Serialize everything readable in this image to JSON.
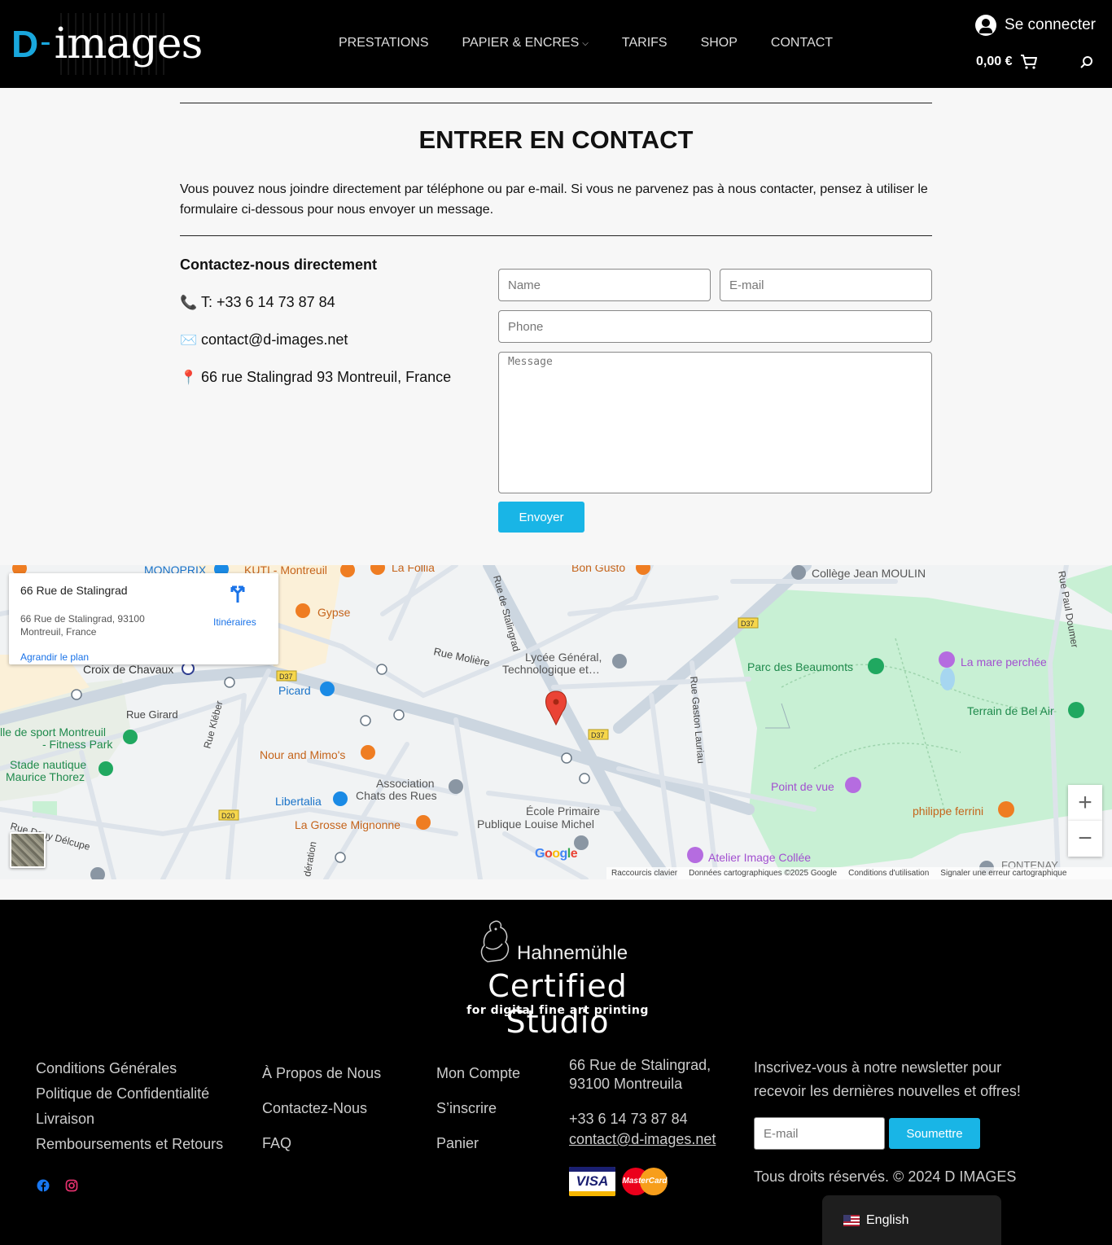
{
  "header": {
    "logo_d": "D",
    "logo_dash": "-",
    "logo_images": "images",
    "nav": [
      {
        "label": "PRESTATIONS"
      },
      {
        "label": "PAPIER & ENCRES",
        "has_dropdown": true
      },
      {
        "label": "TARIFS"
      },
      {
        "label": "SHOP"
      },
      {
        "label": "CONTACT"
      }
    ],
    "login_label": "Se connecter",
    "cart_total": "0,00 €"
  },
  "contact": {
    "title": "ENTRER EN CONTACT",
    "intro": "Vous pouvez nous joindre directement par téléphone ou par e-mail. Si vous ne parvenez pas à nous contacter, pensez à utiliser le formulaire ci-dessous pour nous envoyer un message.",
    "direct_heading": "Contactez-nous directement",
    "phone_icon": "📞",
    "phone": "T: +33 6 14 73 87 84",
    "email_icon": "✉️",
    "email": "contact@d-images.net",
    "address_icon": "📍",
    "address": "66 rue Stalingrad 93 Montreuil, France",
    "form": {
      "name_placeholder": "Name",
      "email_placeholder": "E-mail",
      "phone_placeholder": "Phone",
      "message_placeholder": "Message",
      "submit_label": "Envoyer"
    }
  },
  "map": {
    "card_title": "66 Rue de Stalingrad",
    "card_address": "66 Rue de Stalingrad, 93100 Montreuil, France",
    "card_enlarge": "Agrandir le plan",
    "card_directions": "Itinéraires",
    "zoom_in": "+",
    "zoom_out": "−",
    "footer": {
      "shortcuts": "Raccourcis clavier",
      "data": "Données cartographiques ©2025 Google",
      "terms": "Conditions d'utilisation",
      "report": "Signaler une erreur cartographique"
    },
    "labels": {
      "monoprix": "MONOPRIX",
      "kuti": "KUTI - Montreuil",
      "lafollia": "La Follia",
      "bongusto": "Bon Gusto",
      "college": "Collège Jean MOULIN",
      "rue_paul": "Rue Paul Doumer",
      "gypse": "Gypse",
      "stalingrad": "Rue de Stalingrad",
      "moliere": "Rue Molière",
      "lycee1": "Lycée Général,",
      "lycee2": "Technologique et…",
      "croix": "Croix de Chavaux",
      "picard": "Picard",
      "rue_girard": "Rue Girard",
      "kleber": "Rue Kléber",
      "sport1": "lle de sport Montreuil",
      "sport2": "- Fitness Park",
      "nautique1": "Stade nautique",
      "nautique2": "Maurice Thorez",
      "nour": "Nour and Mimo's",
      "asso1": "Association",
      "asso2": "Chats des Rues",
      "libertalia": "Libertalia",
      "mignonne": "La Grosse Mignonne",
      "ecole1": "École Primaire",
      "ecole2": "Publique Louise Michel",
      "douy": "Rue Douy Délcupe",
      "gaston": "Rue Gaston Lauriau",
      "beaumonts": "Parc des Beaumonts",
      "mare": "La mare perchée",
      "belair": "Terrain de Bel Air",
      "pointvue": "Point de vue",
      "ferrini": "philippe ferrini",
      "atelier": "Atelier Image Collée",
      "fontenay": "FONTENAY",
      "d37a": "D37",
      "d37b": "D37",
      "d37c": "D37",
      "d20": "D20",
      "federation": "dération",
      "google": "Google"
    }
  },
  "footer": {
    "cert_brand": "Hahnemühle",
    "cert_title": "Certified Studio",
    "cert_sub": "for digital fine art printing",
    "col1": [
      "Conditions Générales",
      "Politique de Confidentialité",
      "Livraison",
      "Remboursements et Retours"
    ],
    "col2": [
      "À Propos de Nous",
      "Contactez-Nous",
      "FAQ"
    ],
    "col3": [
      "Mon Compte",
      "S’inscrire",
      "Panier"
    ],
    "col4_address1": "66 Rue de Stalingrad,",
    "col4_address2": "93100 Montreuila",
    "col4_phone": "+33 6 14 73 87 84",
    "col4_email": "contact@d-images.net",
    "visa": "VISA",
    "mastercard": "MasterCard",
    "newsletter_text": "Inscrivez-vous à notre newsletter pour recevoir les dernières nouvelles et offres!",
    "newsletter_placeholder": "E-mail",
    "newsletter_button": "Soumettre",
    "rights": "Tous droits réservés. © 2024 D IMAGES",
    "language": "English"
  },
  "colors": {
    "accent": "#19b5e6",
    "logo_blue": "#19a7dd",
    "header_bg": "#000000",
    "map_park": "#c8f0d4"
  }
}
